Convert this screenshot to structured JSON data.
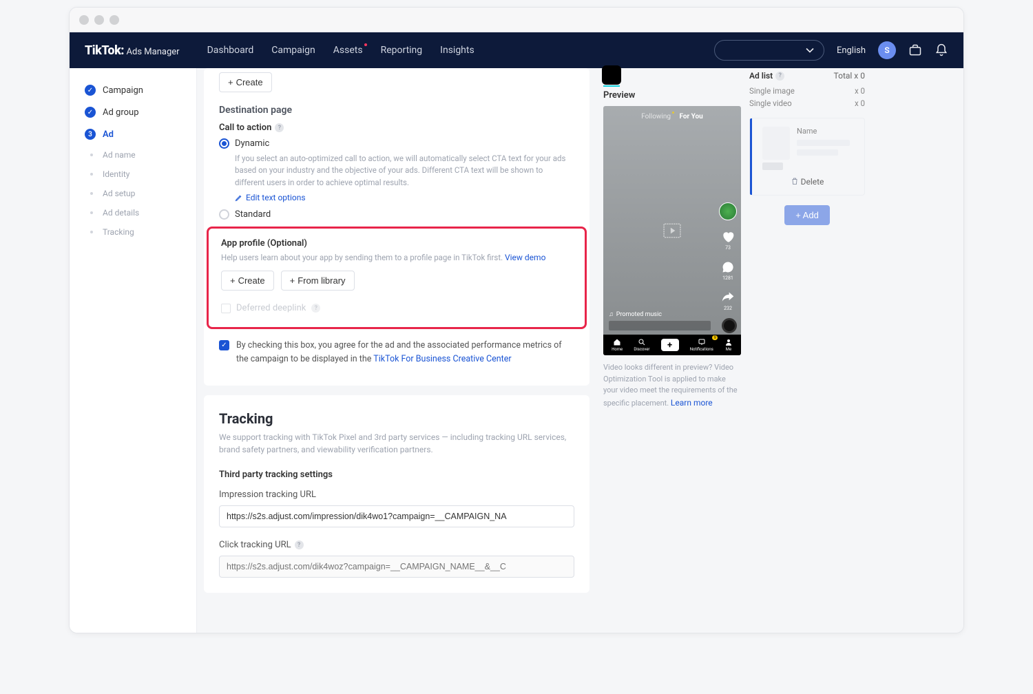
{
  "brand": {
    "main": "TikTok:",
    "sub": "Ads Manager"
  },
  "nav": {
    "dashboard": "Dashboard",
    "campaign": "Campaign",
    "assets": "Assets",
    "reporting": "Reporting",
    "insights": "Insights",
    "language": "English",
    "avatar_letter": "S"
  },
  "sidebar": {
    "campaign": "Campaign",
    "adgroup": "Ad group",
    "ad": "Ad",
    "ad_step_num": "3",
    "subs": {
      "ad_name": "Ad name",
      "identity": "Identity",
      "ad_setup": "Ad setup",
      "ad_details": "Ad details",
      "tracking": "Tracking"
    }
  },
  "create_btn": "Create",
  "destination": {
    "section": "Destination page",
    "cta_label": "Call to action",
    "dynamic": "Dynamic",
    "dynamic_help": "If you select an auto-optimized call to action, we will automatically select CTA text for your ads based on your industry and the objective of your ads. Different CTA text will be shown to different users in order to achieve optimal results.",
    "edit_text": "Edit text options",
    "standard": "Standard"
  },
  "app_profile": {
    "title": "App profile (Optional)",
    "help": "Help users learn about your app by sending them to a profile page in TikTok first.",
    "view_demo": "View demo",
    "create": "Create",
    "from_library": "From library",
    "deferred": "Deferred deeplink"
  },
  "agreement": {
    "text": "By checking this box, you agree for the ad and the associated performance metrics of the campaign to be displayed in the",
    "link": "TikTok For Business Creative Center"
  },
  "tracking": {
    "title": "Tracking",
    "desc": "We support tracking with TikTok Pixel and 3rd party services — including tracking URL services, brand safety partners, and viewability verification partners.",
    "third_party": "Third party tracking settings",
    "impression_label": "Impression tracking URL",
    "impression_value": "https://s2s.adjust.com/impression/dik4wo1?campaign=__CAMPAIGN_NA",
    "click_label": "Click tracking URL",
    "click_placeholder": "https://s2s.adjust.com/dik4woz?campaign=__CAMPAIGN_NAME__&__C"
  },
  "preview": {
    "label": "Preview",
    "following": "Following",
    "foryou": "For You",
    "like_count": "73",
    "comment_count": "1281",
    "share_count": "232",
    "music": "Promoted music",
    "tabs": {
      "home": "Home",
      "discover": "Discover",
      "notifications": "Notifications",
      "me": "Me"
    },
    "note": "Video looks different in preview? Video Optimization Tool is applied to make your video meet the requirements of the specific placement.",
    "learn_more": "Learn more"
  },
  "adlist": {
    "title": "Ad list",
    "total_label": "Total x",
    "total_count": "0",
    "single_image": "Single image",
    "single_image_count": "x 0",
    "single_video": "Single video",
    "single_video_count": "x 0",
    "name_label": "Name",
    "delete": "Delete",
    "add": "+ Add"
  }
}
